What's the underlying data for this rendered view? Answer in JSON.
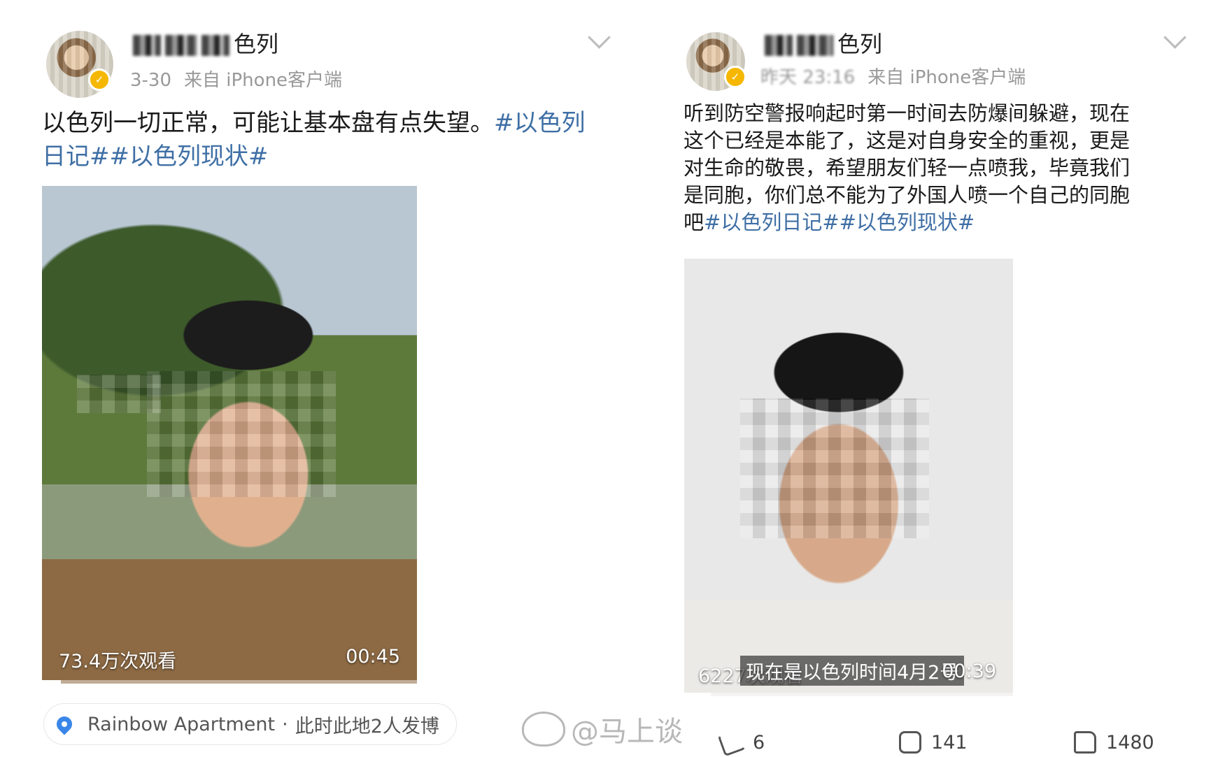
{
  "left_post": {
    "username_suffix": "色列",
    "date": "3-30",
    "source": "来自 iPhone客户端",
    "text_plain": "以色列一切正常，可能让基本盘有点失望。",
    "text_tags": "#以色列日记##以色列现状#",
    "video": {
      "views": "73.4万次观看",
      "duration": "00:45",
      "progress": 0.05
    },
    "location": {
      "name": "Rainbow Apartment",
      "separator": "·",
      "note": "此时此地2人发博"
    }
  },
  "right_post": {
    "username_suffix": "色列",
    "date": "昨天 23:16",
    "source": "来自 iPhone客户端",
    "text_plain": "听到防空警报响起时第一时间去防爆间躲避，现在这个已经是本能了，这是对自身安全的重视，更是对生命的敬畏，希望朋友们轻一点喷我，毕竟我们是同胞，你们总不能为了外国人喷一个自己的同胞吧",
    "text_tags": "#以色列日记##以色列现状#",
    "video": {
      "views": "6227次观看",
      "caption": "现在是以色列时间4月2号",
      "duration": "00:39",
      "progress": 0.08
    },
    "actions": {
      "share_count": "6",
      "comment_count": "141",
      "like_count": "1480"
    }
  },
  "watermark": "@马上谈",
  "icons": [
    "verified-badge-icon",
    "chevron-down-icon",
    "location-pin-icon",
    "weibo-icon",
    "share-icon",
    "comment-icon",
    "like-icon"
  ],
  "colors": {
    "hashtag": "#3f6fa5",
    "verified": "#f5b700",
    "location_pin": "#3a86e8"
  }
}
